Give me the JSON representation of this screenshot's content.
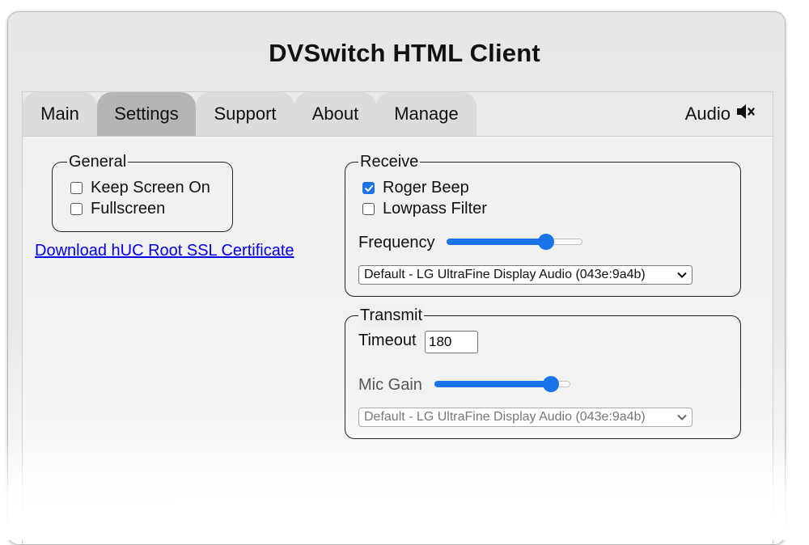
{
  "app": {
    "title": "DVSwitch HTML Client"
  },
  "tabs": [
    {
      "label": "Main"
    },
    {
      "label": "Settings"
    },
    {
      "label": "Support"
    },
    {
      "label": "About"
    },
    {
      "label": "Manage"
    }
  ],
  "audio_toggle": {
    "label": "Audio",
    "icon": "speaker-muted-icon"
  },
  "general": {
    "legend": "General",
    "keep_screen_on": {
      "label": "Keep Screen On",
      "checked": false
    },
    "fullscreen": {
      "label": "Fullscreen",
      "checked": false
    }
  },
  "certificate_link": "Download hUC Root SSL Certificate",
  "receive": {
    "legend": "Receive",
    "roger_beep": {
      "label": "Roger Beep",
      "checked": true
    },
    "lowpass_filter": {
      "label": "Lowpass Filter",
      "checked": false
    },
    "frequency": {
      "label": "Frequency",
      "level": 0.73
    },
    "device": "Default - LG UltraFine Display Audio (043e:9a4b)"
  },
  "transmit": {
    "legend": "Transmit",
    "timeout": {
      "label": "Timeout",
      "value": "180"
    },
    "mic_gain": {
      "label": "Mic Gain",
      "level": 0.86
    },
    "device": "Default - LG UltraFine Display Audio (043e:9a4b)"
  },
  "colors": {
    "accent": "#1a73e8",
    "active_tab": "#b5b5b5",
    "tab": "#dcdcdc",
    "link": "#0000ee"
  }
}
